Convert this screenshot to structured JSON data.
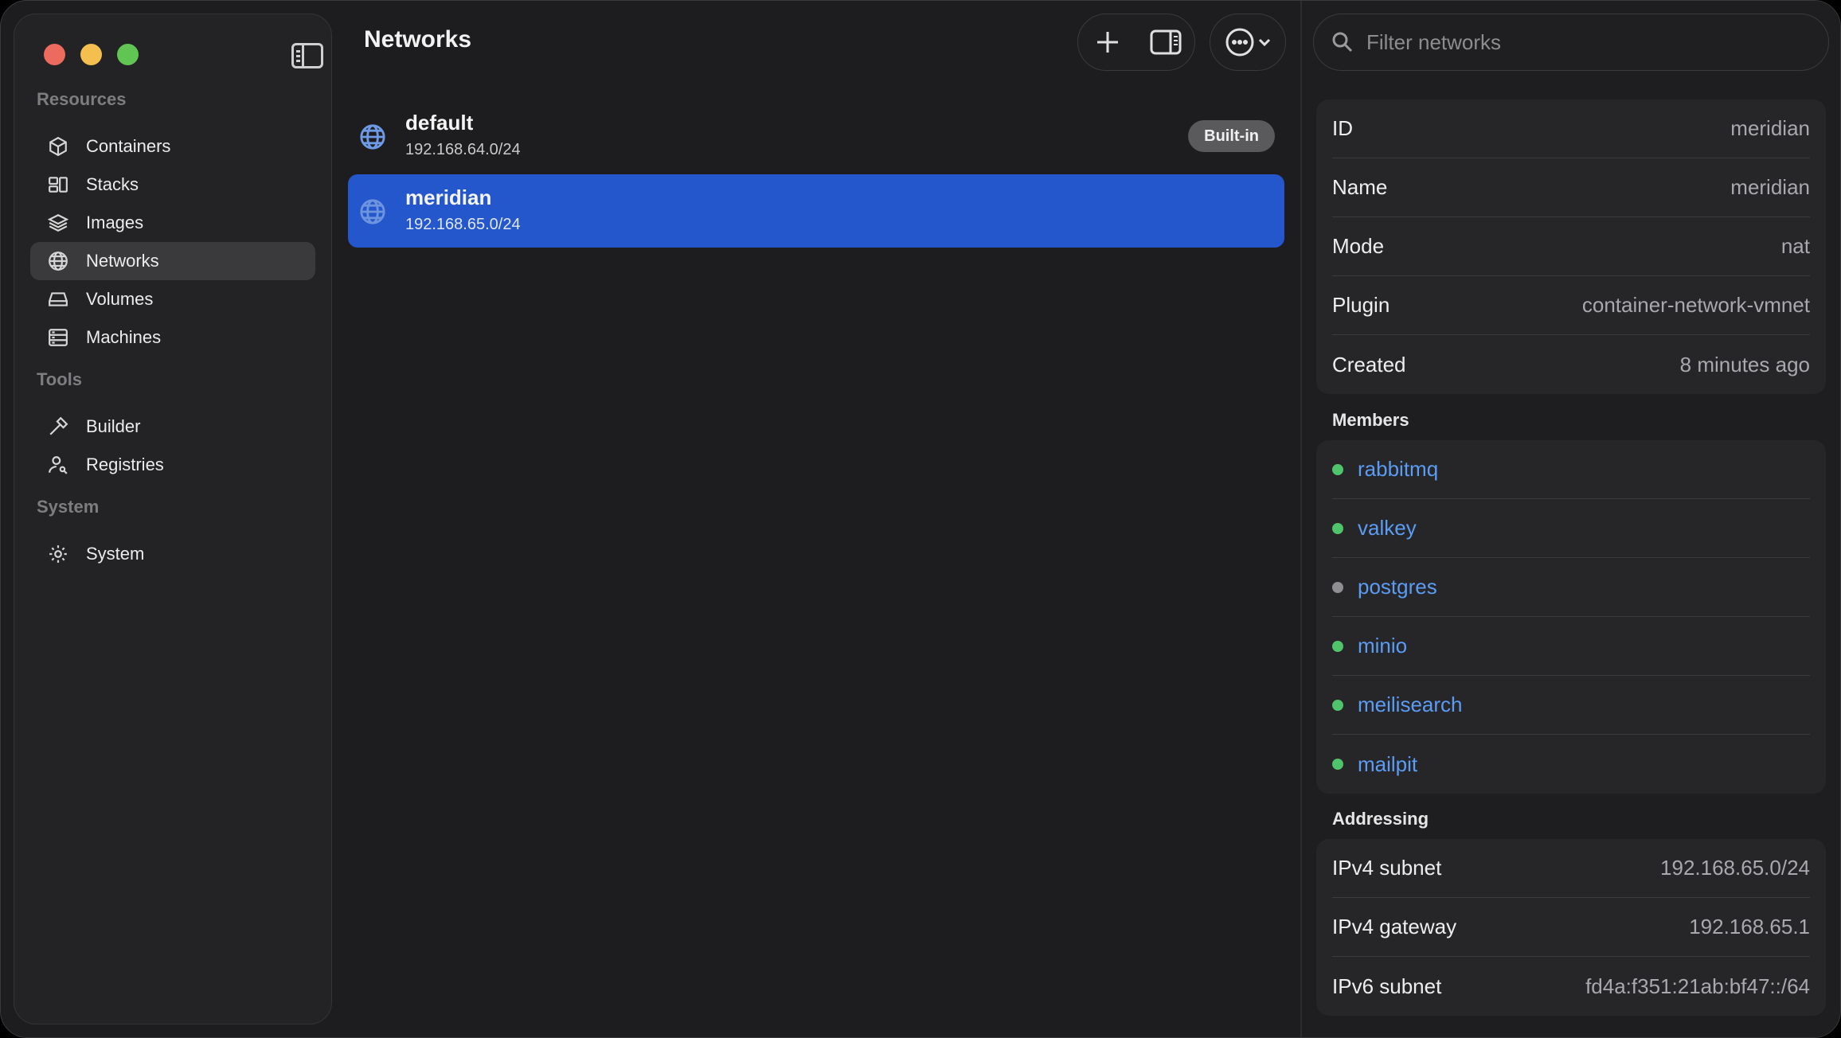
{
  "sidebar": {
    "sections": [
      {
        "label": "Resources",
        "items": [
          {
            "label": "Containers",
            "icon": "cube-icon"
          },
          {
            "label": "Stacks",
            "icon": "stacks-icon"
          },
          {
            "label": "Images",
            "icon": "layers-icon"
          },
          {
            "label": "Networks",
            "icon": "globe-icon",
            "active": true
          },
          {
            "label": "Volumes",
            "icon": "drive-icon"
          },
          {
            "label": "Machines",
            "icon": "server-icon"
          }
        ]
      },
      {
        "label": "Tools",
        "items": [
          {
            "label": "Builder",
            "icon": "hammer-icon"
          },
          {
            "label": "Registries",
            "icon": "person-key-icon"
          }
        ]
      },
      {
        "label": "System",
        "items": [
          {
            "label": "System",
            "icon": "gear-icon"
          }
        ]
      }
    ]
  },
  "main": {
    "title": "Networks",
    "networks": [
      {
        "name": "default",
        "subnet": "192.168.64.0/24",
        "badge": "Built-in",
        "selected": false
      },
      {
        "name": "meridian",
        "subnet": "192.168.65.0/24",
        "badge": "",
        "selected": true
      }
    ]
  },
  "detail": {
    "search_placeholder": "Filter networks",
    "info": [
      {
        "key": "ID",
        "value": "meridian"
      },
      {
        "key": "Name",
        "value": "meridian"
      },
      {
        "key": "Mode",
        "value": "nat"
      },
      {
        "key": "Plugin",
        "value": "container-network-vmnet"
      },
      {
        "key": "Created",
        "value": "8 minutes ago"
      }
    ],
    "members_heading": "Members",
    "members": [
      {
        "name": "rabbitmq",
        "status": "running"
      },
      {
        "name": "valkey",
        "status": "running"
      },
      {
        "name": "postgres",
        "status": "stopped"
      },
      {
        "name": "minio",
        "status": "running"
      },
      {
        "name": "meilisearch",
        "status": "running"
      },
      {
        "name": "mailpit",
        "status": "running"
      }
    ],
    "addressing_heading": "Addressing",
    "addressing": [
      {
        "key": "IPv4 subnet",
        "value": "192.168.65.0/24"
      },
      {
        "key": "IPv4 gateway",
        "value": "192.168.65.1"
      },
      {
        "key": "IPv6 subnet",
        "value": "fd4a:f351:21ab:bf47::/64"
      }
    ]
  },
  "colors": {
    "accent": "#2457cc",
    "link": "#5b9cf5",
    "status_running": "#4fc46a",
    "status_stopped": "#8e8e93"
  }
}
